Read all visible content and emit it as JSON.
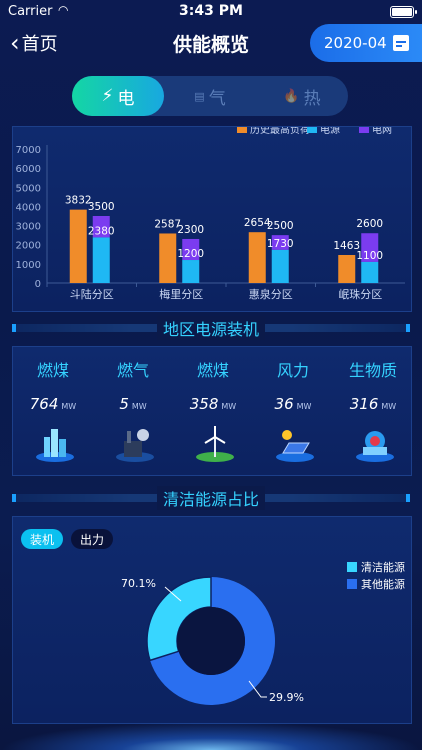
{
  "status": {
    "carrier": "Carrier",
    "time": "3:43 PM"
  },
  "nav": {
    "back_label": "首页",
    "title": "供能概览",
    "date": "2020-04"
  },
  "tabs": [
    {
      "label": "电",
      "icon": "⚡",
      "active": true
    },
    {
      "label": "气",
      "icon": "▤",
      "active": false
    },
    {
      "label": "热",
      "icon": "🔥",
      "active": false
    }
  ],
  "chart_data": {
    "type": "bar",
    "legend": [
      "历史最高负荷",
      "电源",
      "电网"
    ],
    "colors": [
      "#f08c2a",
      "#1fb8f4",
      "#7b3cf0"
    ],
    "categories": [
      "斗陆分区",
      "梅里分区",
      "惠泉分区",
      "岷珠分区"
    ],
    "series": [
      {
        "name": "历史最高负荷",
        "values": [
          3832,
          2587,
          2654,
          1463
        ]
      },
      {
        "name": "电源",
        "values": [
          2380,
          1200,
          1730,
          1100
        ]
      },
      {
        "name": "电网",
        "values": [
          3500,
          2300,
          2500,
          2600
        ]
      }
    ],
    "yticks": [
      "0",
      "1000",
      "2000",
      "3000",
      "4000",
      "5000",
      "6000",
      "7000"
    ],
    "ylim": [
      0,
      7000
    ]
  },
  "sections": {
    "power": "地区电源装机",
    "clean": "清洁能源占比"
  },
  "power": [
    {
      "name": "燃煤",
      "value": "764",
      "unit": "MW",
      "icon": "city-icon"
    },
    {
      "name": "燃气",
      "value": "5",
      "unit": "MW",
      "icon": "gas-plant-icon"
    },
    {
      "name": "燃煤",
      "value": "358",
      "unit": "MW",
      "icon": "wind-turbine-icon"
    },
    {
      "name": "风力",
      "value": "36",
      "unit": "MW",
      "icon": "solar-panel-icon"
    },
    {
      "name": "生物质",
      "value": "316",
      "unit": "MW",
      "icon": "biomass-icon"
    }
  ],
  "clean": {
    "toggle_on": "装机",
    "toggle_off": "出力",
    "legend": [
      "清洁能源",
      "其他能源"
    ],
    "colors": [
      "#38d6ff",
      "#2a6ff0"
    ],
    "pct_other": "70.1%",
    "pct_clean": "29.9%",
    "values": [
      29.9,
      70.1
    ]
  }
}
